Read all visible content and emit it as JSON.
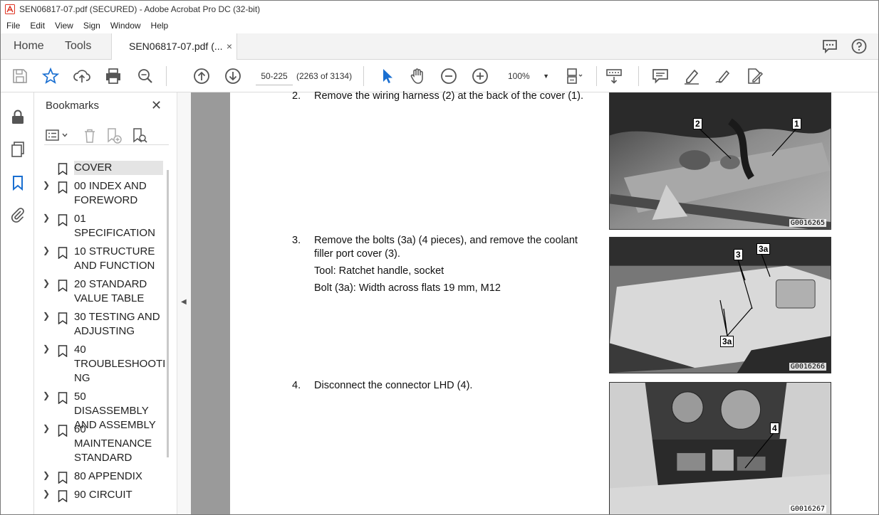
{
  "window": {
    "title": "SEN06817-07.pdf (SECURED) - Adobe Acrobat Pro DC (32-bit)"
  },
  "menu": {
    "items": [
      "File",
      "Edit",
      "View",
      "Sign",
      "Window",
      "Help"
    ]
  },
  "tabs": {
    "home": "Home",
    "tools": "Tools",
    "document": "SEN06817-07.pdf (...",
    "close": "×"
  },
  "toolbar": {
    "page_input": "50-225",
    "page_count": "(2263 of 3134)",
    "zoom": "100%"
  },
  "bookmarks": {
    "title": "Bookmarks",
    "items": [
      {
        "label": "COVER",
        "expandable": false,
        "selected": true
      },
      {
        "label": "00 INDEX AND FOREWORD",
        "expandable": true
      },
      {
        "label": "01 SPECIFICATION",
        "expandable": true
      },
      {
        "label": "10 STRUCTURE AND FUNCTION",
        "expandable": true
      },
      {
        "label": "20 STANDARD VALUE TABLE",
        "expandable": true
      },
      {
        "label": "30 TESTING AND ADJUSTING",
        "expandable": true
      },
      {
        "label": "40 TROUBLESHOOTING",
        "expandable": true
      },
      {
        "label": "50 DISASSEMBLY AND ASSEMBLY",
        "expandable": true
      },
      {
        "label": "60 MAINTENANCE STANDARD",
        "expandable": true
      },
      {
        "label": "80 APPENDIX",
        "expandable": true
      },
      {
        "label": "90 CIRCUIT",
        "expandable": true
      }
    ],
    "display_lines": [
      [
        "COVER"
      ],
      [
        " 00 INDEX AND",
        "FOREWORD"
      ],
      [
        " 01",
        "SPECIFICATION"
      ],
      [
        " 10 STRUCTURE",
        "AND FUNCTION"
      ],
      [
        " 20 STANDARD",
        "VALUE TABLE"
      ],
      [
        " 30 TESTING AND",
        "ADJUSTING"
      ],
      [
        " 40",
        "TROUBLESHOOTI",
        "NG"
      ],
      [
        " 50 DISASSEMBLY",
        "AND ASSEMBLY"
      ],
      [
        " 60",
        "MAINTENANCE",
        "STANDARD"
      ],
      [
        " 80 APPENDIX"
      ],
      [
        " 90 CIRCUIT"
      ]
    ]
  },
  "document": {
    "steps": [
      {
        "num": "2.",
        "lines": [
          "Remove the wiring harness (2) at the back of the cover (1)."
        ],
        "figure": "G0016265",
        "callouts": [
          "2",
          "1"
        ]
      },
      {
        "num": "3.",
        "lines": [
          "Remove the bolts (3a) (4 pieces), and remove the coolant filler port cover (3).",
          "Tool: Ratchet handle, socket",
          "Bolt (3a): Width across flats 19 mm, M12"
        ],
        "figure": "G0016266",
        "callouts": [
          "3",
          "3a",
          "3a"
        ]
      },
      {
        "num": "4.",
        "lines": [
          "Disconnect the connector LHD (4)."
        ],
        "figure": "G0016267",
        "callouts": [
          "4"
        ]
      }
    ]
  }
}
